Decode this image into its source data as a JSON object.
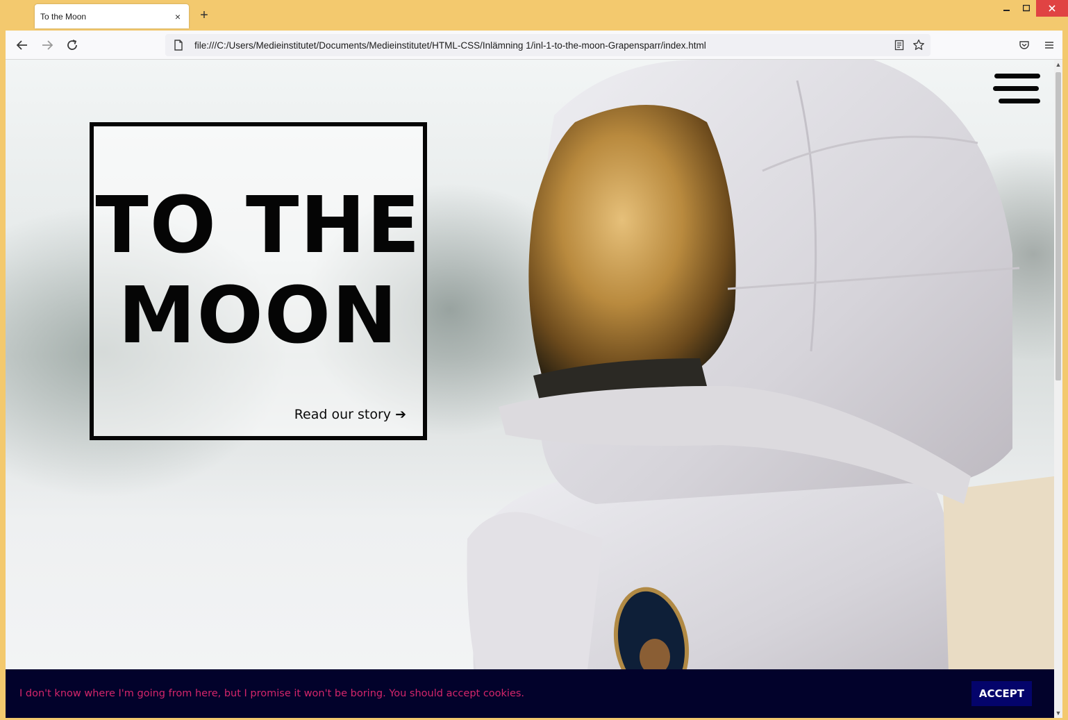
{
  "browser": {
    "tab_title": "To the Moon",
    "tab_close": "×",
    "new_tab": "+",
    "url": "file:///C:/Users/Medieinstitutet/Documents/Medieinstitutet/HTML-CSS/Inlämning 1/inl-1-to-the-moon-Grapensparr/index.html"
  },
  "hero": {
    "title_line1": "TO THE",
    "title_line2": "MOON",
    "read_link": "Read our story ➔"
  },
  "cookie": {
    "message": "I don't know where I'm going from here, but I promise it won't be boring. You should accept cookies.",
    "accept_label": "ACCEPT"
  },
  "colors": {
    "window_frame": "#f3c96e",
    "cookie_bg": "#02022b",
    "cookie_text": "#d4256a",
    "accept_bg": "#04046b"
  },
  "icons": [
    "back-arrow-icon",
    "forward-arrow-icon",
    "reload-icon",
    "page-icon",
    "reader-view-icon",
    "bookmark-star-icon",
    "pocket-icon",
    "app-menu-icon",
    "hamburger-menu-icon"
  ]
}
